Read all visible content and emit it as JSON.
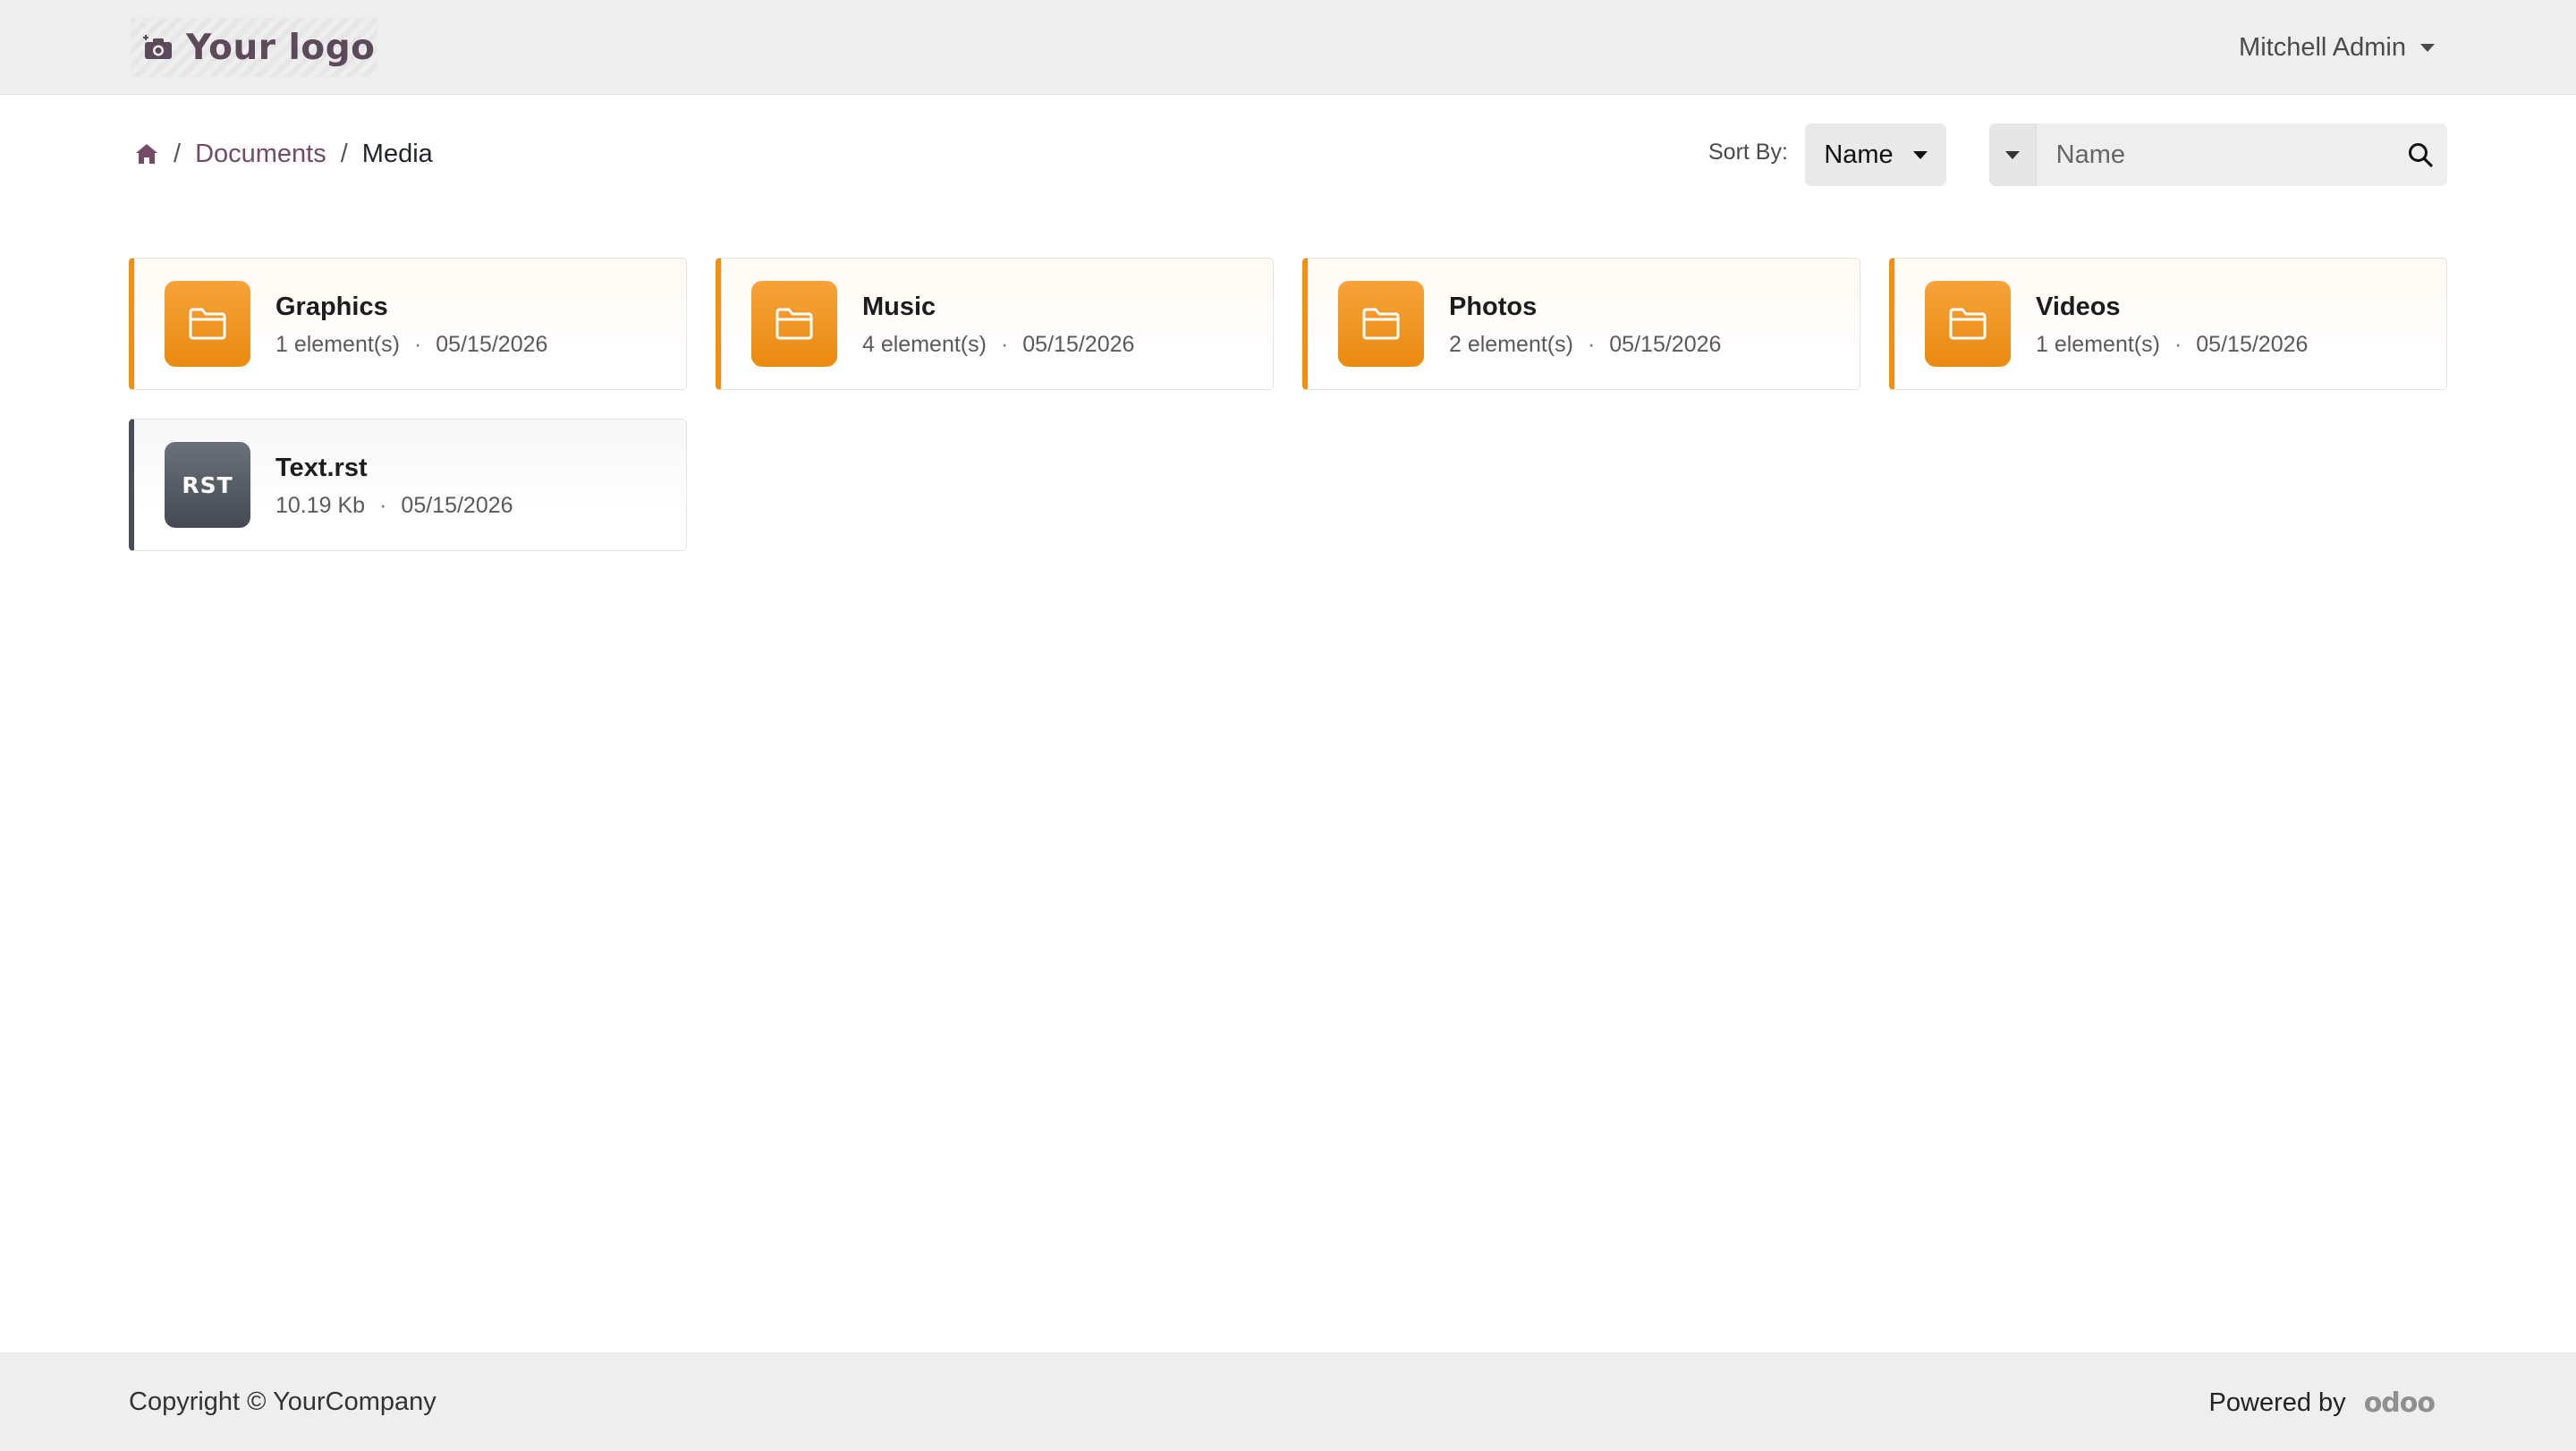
{
  "header": {
    "logo_text": "Your logo",
    "user_name": "Mitchell Admin"
  },
  "breadcrumb": {
    "items": [
      {
        "label": "Documents"
      },
      {
        "label": "Media"
      }
    ]
  },
  "toolbar": {
    "sort_label": "Sort By:",
    "sort_value": "Name",
    "search_placeholder": "Name"
  },
  "cards": [
    {
      "title": "Graphics",
      "meta": "1 element(s)",
      "date": "05/15/2026",
      "kind": "folder",
      "icon": "folder-icon"
    },
    {
      "title": "Music",
      "meta": "4 element(s)",
      "date": "05/15/2026",
      "kind": "folder",
      "icon": "folder-icon"
    },
    {
      "title": "Photos",
      "meta": "2 element(s)",
      "date": "05/15/2026",
      "kind": "folder",
      "icon": "folder-icon"
    },
    {
      "title": "Videos",
      "meta": "1 element(s)",
      "date": "05/15/2026",
      "kind": "folder",
      "icon": "folder-icon"
    },
    {
      "title": "Text.rst",
      "meta": "10.19 Kb",
      "date": "05/15/2026",
      "kind": "file",
      "ext": "RST"
    }
  ],
  "footer": {
    "copyright": "Copyright © YourCompany",
    "powered_by": "Powered by",
    "brand": "odoo"
  },
  "colors": {
    "accent": "#714b67",
    "folder": "#f0901a",
    "file": "#4a4f57"
  }
}
